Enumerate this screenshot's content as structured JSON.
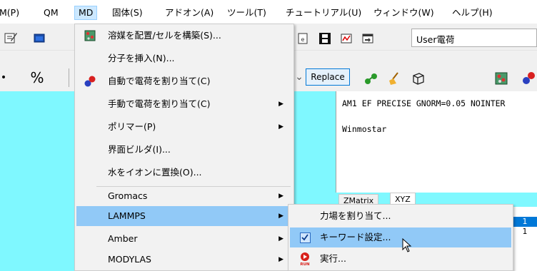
{
  "menubar": {
    "items": [
      "M(P)",
      "QM",
      "MD",
      "固体(S)",
      "アドオン(A)",
      "ツール(T)",
      "チュートリアル(U)",
      "ウィンドウ(W)",
      "ヘルプ(H)"
    ]
  },
  "toolbar": {
    "user_field": "User電荷",
    "replace_label": "Replace",
    "percent_label": "%"
  },
  "keyword_panel": {
    "line1": "AM1 EF PRECISE GNORM=0.05 NOINTER",
    "line2": "Winmostar"
  },
  "tabs": [
    "ZMatrix",
    "XYZ"
  ],
  "right_table": {
    "cells": [
      "1",
      "1"
    ]
  },
  "md_menu": {
    "items": [
      {
        "label": "溶媒を配置/セルを構築(S)...",
        "icon": "solvate-cell-icon",
        "submenu": false
      },
      {
        "label": "分子を挿入(N)...",
        "icon": "",
        "submenu": false
      },
      {
        "label": "自動で電荷を割り当て(C)",
        "icon": "auto-charge-icon",
        "submenu": false
      },
      {
        "label": "手動で電荷を割り当て(C)",
        "icon": "",
        "submenu": true
      },
      {
        "label": "ポリマー(P)",
        "icon": "",
        "submenu": true
      },
      {
        "label": "界面ビルダ(I)...",
        "icon": "",
        "submenu": false
      },
      {
        "label": "水をイオンに置換(O)...",
        "icon": "",
        "submenu": false
      },
      {
        "label": "Gromacs",
        "icon": "",
        "submenu": true
      },
      {
        "label": "LAMMPS",
        "icon": "",
        "submenu": true
      },
      {
        "label": "Amber",
        "icon": "",
        "submenu": true
      },
      {
        "label": "MODYLAS",
        "icon": "",
        "submenu": true
      }
    ]
  },
  "lammps_submenu": {
    "items": [
      {
        "label": "力場を割り当て...",
        "icon": ""
      },
      {
        "label": "キーワード設定...",
        "icon": "checkbox-icon"
      },
      {
        "label": "実行...",
        "icon": "run-icon"
      }
    ]
  },
  "colors": {
    "highlight": "#91c9f7",
    "viewport": "#7ff8ff",
    "menu_bg": "#f2f2f2",
    "active_menubar": "#cce8ff"
  }
}
